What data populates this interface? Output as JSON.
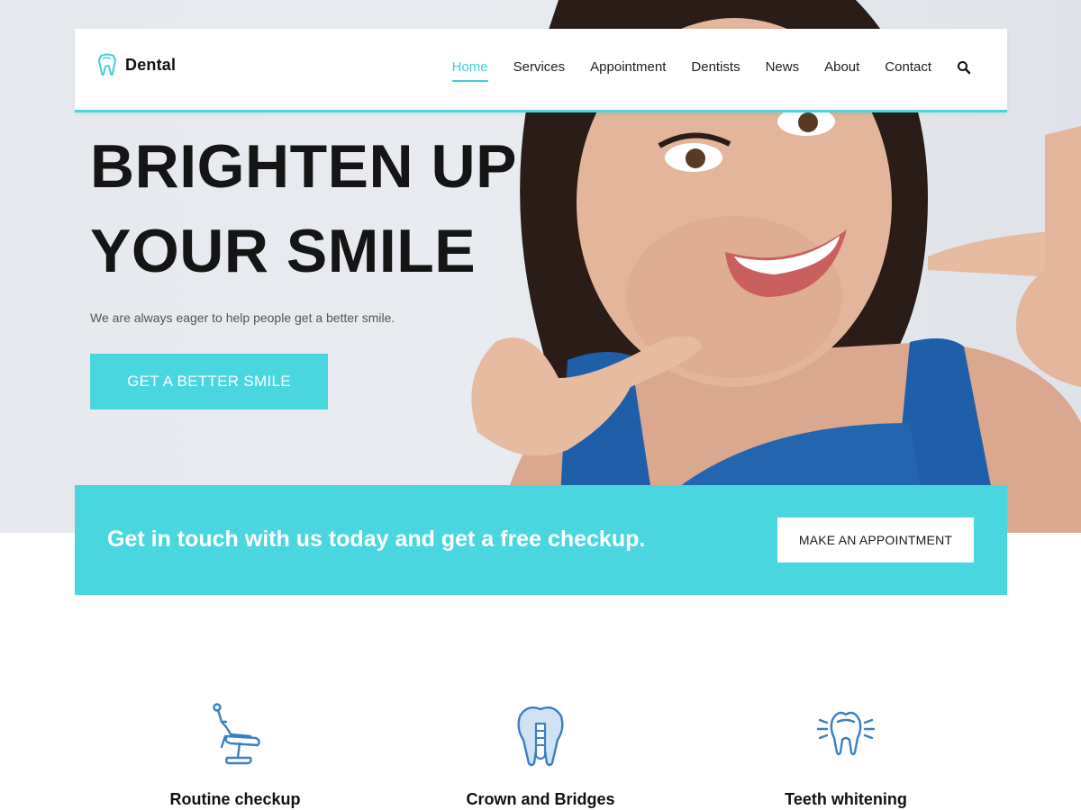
{
  "brand": {
    "name": "Dental",
    "logo_icon": "tooth-icon"
  },
  "nav": {
    "items": [
      {
        "label": "Home",
        "active": true
      },
      {
        "label": "Services",
        "active": false
      },
      {
        "label": "Appointment",
        "active": false
      },
      {
        "label": "Dentists",
        "active": false
      },
      {
        "label": "News",
        "active": false
      },
      {
        "label": "About",
        "active": false
      },
      {
        "label": "Contact",
        "active": false
      }
    ],
    "search_icon": "search-icon"
  },
  "hero": {
    "title_line1": "BRIGHTEN UP",
    "title_line2": "YOUR SMILE",
    "subtitle": "We are always eager to help people get a better smile.",
    "button_label": "GET A BETTER SMILE"
  },
  "cta": {
    "text": "Get in touch with us today and get a free checkup.",
    "button_label": "MAKE AN APPOINTMENT"
  },
  "services": [
    {
      "title": "Routine checkup",
      "icon": "dental-chair-icon"
    },
    {
      "title": "Crown and Bridges",
      "icon": "dental-implant-icon"
    },
    {
      "title": "Teeth whitening",
      "icon": "shining-tooth-icon"
    }
  ],
  "colors": {
    "accent": "#4ad6df",
    "text_dark": "#151515",
    "icon_blue": "#3a7fc4"
  }
}
